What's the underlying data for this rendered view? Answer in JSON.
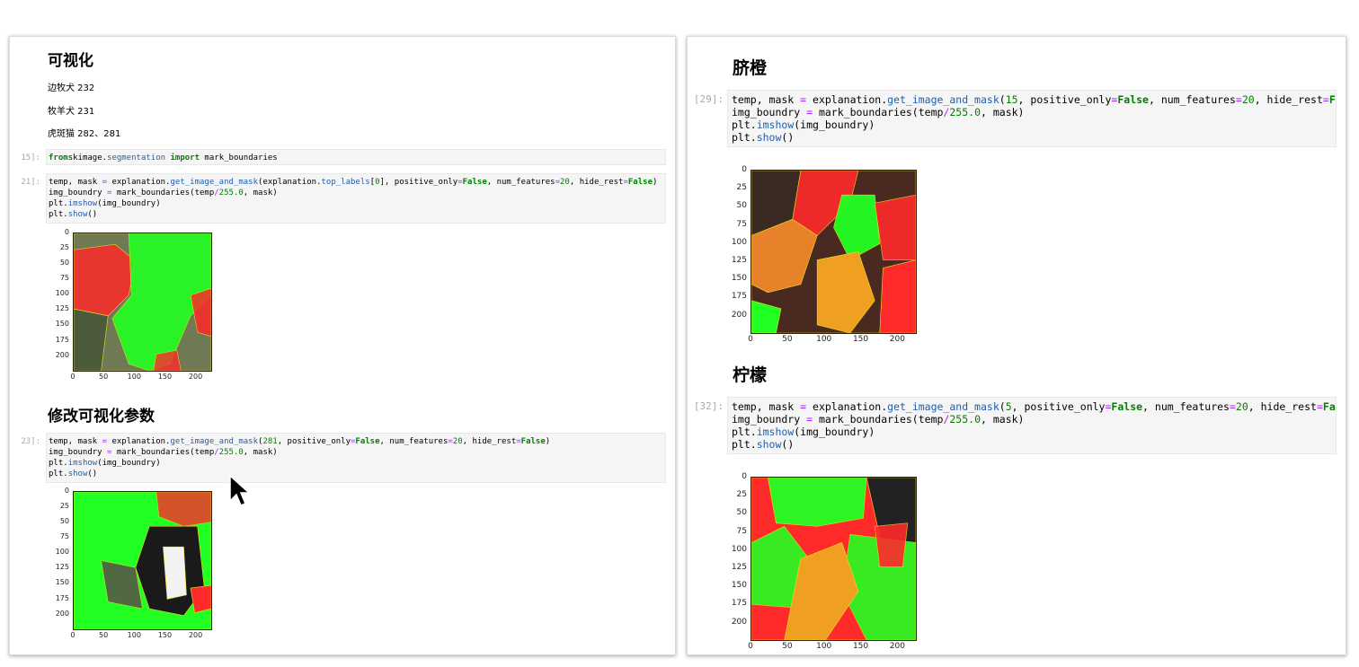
{
  "left": {
    "heading_visualize": "可视化",
    "notes": [
      "边牧犬 232",
      "牧羊犬 231",
      "虎斑猫 282、281"
    ],
    "cell15": {
      "prompt": "15]:",
      "lines": [
        [
          [
            "kw",
            "from"
          ],
          [
            "",
            "skimage"
          ],
          [
            "",
            "."
          ],
          [
            "fn",
            "segmentation"
          ],
          [
            "",
            ""
          ],
          [
            "kw",
            " import"
          ],
          [
            "",
            " mark_boundaries"
          ]
        ]
      ]
    },
    "cell21": {
      "prompt": "21]:",
      "lines": [
        [
          [
            "",
            "temp, mask "
          ],
          [
            "op",
            "="
          ],
          [
            "",
            " explanation."
          ],
          [
            "fn",
            "get_image_and_mask"
          ],
          [
            "",
            "(explanation."
          ],
          [
            "fn",
            "top_labels"
          ],
          [
            "",
            "["
          ],
          [
            "num",
            "0"
          ],
          [
            "",
            "], positive_only"
          ],
          [
            "op",
            "="
          ],
          [
            "kw2",
            "False"
          ],
          [
            "",
            ", num_features"
          ],
          [
            "op",
            "="
          ],
          [
            "num",
            "20"
          ],
          [
            "",
            ", hide_rest"
          ],
          [
            "op",
            "="
          ],
          [
            "kw2",
            "False"
          ],
          [
            "",
            ")"
          ]
        ],
        [
          [
            "",
            "img_boundry "
          ],
          [
            "op",
            "="
          ],
          [
            "",
            " mark_boundaries(temp"
          ],
          [
            "op",
            "/"
          ],
          [
            "num",
            "255.0"
          ],
          [
            "",
            ", mask)"
          ]
        ],
        [
          [
            "",
            "plt."
          ],
          [
            "fn",
            "imshow"
          ],
          [
            "",
            "(img_boundry)"
          ]
        ],
        [
          [
            "",
            "plt."
          ],
          [
            "fn",
            "show"
          ],
          [
            "",
            "()"
          ]
        ]
      ]
    },
    "heading_modify": "修改可视化参数",
    "cell23": {
      "prompt": "23]:",
      "lines": [
        [
          [
            "",
            "temp, mask "
          ],
          [
            "op",
            "="
          ],
          [
            "",
            " explanation."
          ],
          [
            "fn",
            "get_image_and_mask"
          ],
          [
            "",
            "("
          ],
          [
            "num",
            "281"
          ],
          [
            "",
            ", positive_only"
          ],
          [
            "op",
            "="
          ],
          [
            "kw2",
            "False"
          ],
          [
            "",
            ", num_features"
          ],
          [
            "op",
            "="
          ],
          [
            "num",
            "20"
          ],
          [
            "",
            ", hide_rest"
          ],
          [
            "op",
            "="
          ],
          [
            "kw2",
            "False"
          ],
          [
            "",
            ")"
          ]
        ],
        [
          [
            "",
            "img_boundry "
          ],
          [
            "op",
            "="
          ],
          [
            "",
            " mark_boundaries(temp"
          ],
          [
            "op",
            "/"
          ],
          [
            "num",
            "255.0"
          ],
          [
            "",
            ", mask)"
          ]
        ],
        [
          [
            "",
            "plt."
          ],
          [
            "fn",
            "imshow"
          ],
          [
            "",
            "(img_boundry)"
          ]
        ],
        [
          [
            "",
            "plt."
          ],
          [
            "fn",
            "show"
          ],
          [
            "",
            "()"
          ]
        ]
      ]
    }
  },
  "right": {
    "heading_navel_orange": "脐橙",
    "cell29": {
      "prompt": "[29]:",
      "lines": [
        [
          [
            "",
            "temp, mask "
          ],
          [
            "op",
            "="
          ],
          [
            "",
            " explanation."
          ],
          [
            "fn",
            "get_image_and_mask"
          ],
          [
            "",
            "("
          ],
          [
            "num",
            "15"
          ],
          [
            "",
            ", positive_only"
          ],
          [
            "op",
            "="
          ],
          [
            "kw2",
            "False"
          ],
          [
            "",
            ", num_features"
          ],
          [
            "op",
            "="
          ],
          [
            "num",
            "20"
          ],
          [
            "",
            ", hide_rest"
          ],
          [
            "op",
            "="
          ],
          [
            "kw2",
            "False"
          ],
          [
            "",
            ")"
          ]
        ],
        [
          [
            "",
            "img_boundry "
          ],
          [
            "op",
            "="
          ],
          [
            "",
            " mark_boundaries(temp"
          ],
          [
            "op",
            "/"
          ],
          [
            "num",
            "255.0"
          ],
          [
            "",
            ", mask)"
          ]
        ],
        [
          [
            "",
            "plt."
          ],
          [
            "fn",
            "imshow"
          ],
          [
            "",
            "(img_boundry)"
          ]
        ],
        [
          [
            "",
            "plt."
          ],
          [
            "fn",
            "show"
          ],
          [
            "",
            "()"
          ]
        ]
      ]
    },
    "heading_lemon": "柠檬",
    "cell32": {
      "prompt": "[32]:",
      "lines": [
        [
          [
            "",
            "temp, mask "
          ],
          [
            "op",
            "="
          ],
          [
            "",
            " explanation."
          ],
          [
            "fn",
            "get_image_and_mask"
          ],
          [
            "",
            "("
          ],
          [
            "num",
            "5"
          ],
          [
            "",
            ", positive_only"
          ],
          [
            "op",
            "="
          ],
          [
            "kw2",
            "False"
          ],
          [
            "",
            ", num_features"
          ],
          [
            "op",
            "="
          ],
          [
            "num",
            "20"
          ],
          [
            "",
            ", hide_rest"
          ],
          [
            "op",
            "="
          ],
          [
            "kw2",
            "False"
          ],
          [
            "",
            ")"
          ]
        ],
        [
          [
            "",
            "img_boundry "
          ],
          [
            "op",
            "="
          ],
          [
            "",
            " mark_boundaries(temp"
          ],
          [
            "op",
            "/"
          ],
          [
            "num",
            "255.0"
          ],
          [
            "",
            ", mask)"
          ]
        ],
        [
          [
            "",
            "plt."
          ],
          [
            "fn",
            "imshow"
          ],
          [
            "",
            "(img_boundry)"
          ]
        ],
        [
          [
            "",
            "plt."
          ],
          [
            "fn",
            "show"
          ],
          [
            "",
            "()"
          ]
        ]
      ]
    }
  },
  "plots": {
    "y_ticks": [
      "0",
      "25",
      "50",
      "75",
      "100",
      "125",
      "150",
      "175",
      "200"
    ],
    "x_ticks": [
      "0",
      "50",
      "100",
      "150",
      "200"
    ],
    "colors": {
      "positive": "#22ff22",
      "negative": "#ff2a2a",
      "boundary": "#f0e020"
    }
  }
}
